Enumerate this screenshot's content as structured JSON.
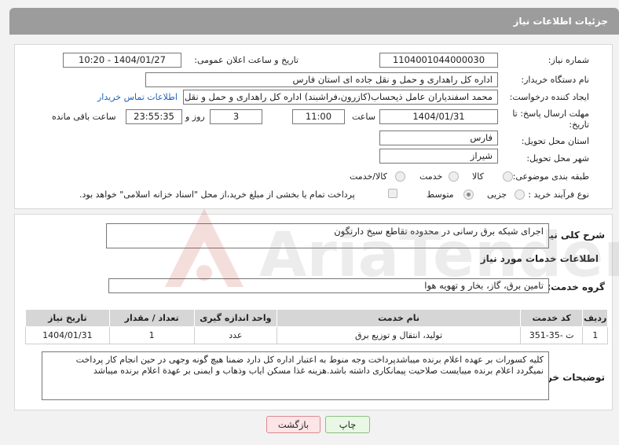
{
  "header": {
    "title": "جزئیات اطلاعات نیاز"
  },
  "form": {
    "need_number_label": "شماره نیاز:",
    "need_number": "1104001044000030",
    "announce_label": "تاریخ و ساعت اعلان عمومی:",
    "announce_value": "1404/01/27 - 10:20",
    "buyer_org_label": "نام دستگاه خریدار:",
    "buyer_org": "اداره کل راهداری و حمل و نقل جاده ای استان فارس",
    "creator_label": "ایجاد کننده درخواست:",
    "creator": "محمد اسفندیاران عامل ذیحساب(کازرون،فراشبند) اداره کل راهداری و حمل و نقل",
    "contact_link": "اطلاعات تماس خریدار",
    "deadline_label_1": "مهلت ارسال پاسخ: تا",
    "deadline_label_2": "تاریخ:",
    "deadline_date": "1404/01/31",
    "time_label": "ساعت",
    "deadline_time": "11:00",
    "days_value": "3",
    "days_label": "روز و",
    "remaining_time": "23:55:35",
    "remaining_label": "ساعت باقی مانده",
    "province_label": "استان محل تحویل:",
    "province": "فارس",
    "city_label": "شهر محل تحویل:",
    "city": "شیراز",
    "category_label": "طبقه بندی موضوعی:",
    "category_options": [
      "کالا",
      "خدمت",
      "کالا/خدمت"
    ],
    "process_label": "نوع فرآیند خرید :",
    "process_options": [
      "جزیی",
      "متوسط"
    ],
    "payment_note": "پرداخت تمام یا بخشی از مبلغ خرید،از محل \"اسناد خزانه اسلامی\" خواهد بود."
  },
  "summary": {
    "label": "شرح کلی نیاز:",
    "value": "اجرای شبکه برق رسانی در محدوده تقاطع سیخ دارنگون"
  },
  "services": {
    "title": "اطلاعات خدمات مورد نیاز",
    "group_label": "گروه خدمت:",
    "group_value": "تامین برق، گاز، بخار و تهویه هوا",
    "columns": [
      "ردیف",
      "کد خدمت",
      "نام خدمت",
      "واحد اندازه گیری",
      "تعداد / مقدار",
      "تاریخ نیاز"
    ],
    "rows": [
      [
        "1",
        "ت -35-351",
        "تولید، انتقال و توزیع برق",
        "عدد",
        "1",
        "1404/01/31"
      ]
    ]
  },
  "notes": {
    "label": "توضیحات خریدار:",
    "value": "کلیه کسورات بر عهده اعلام برنده میباشدپرداخت وجه  منوط به اعتبار اداره کل دارد ضمنا هیچ گونه وجهی در حین انجام کار پرداخت نمیگردد اعلام برنده میبایست صلاحیت پیمانکاری داشته باشد.هزینه غذا مسکن ایاب وذهاب و ایمنی بر عهدة اعلام برنده میباشد"
  },
  "buttons": {
    "print": "چاپ",
    "back": "بازگشت"
  },
  "watermark": {
    "text": "AriaTender.neT"
  }
}
